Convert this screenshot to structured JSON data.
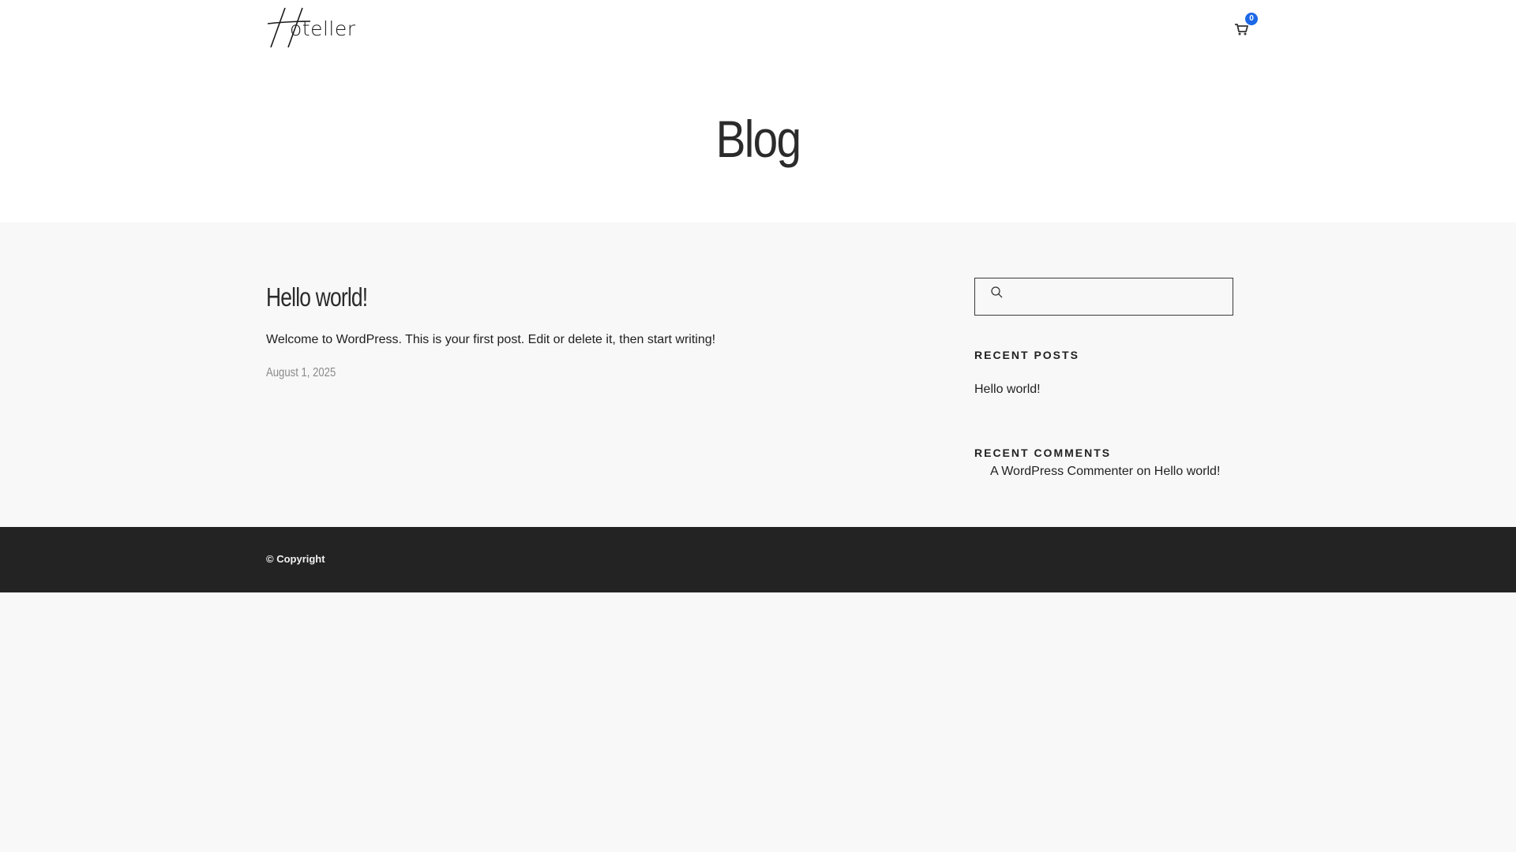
{
  "header": {
    "logo_text": "oteller",
    "cart_count": "0"
  },
  "page": {
    "title": "Blog"
  },
  "post": {
    "title": "Hello world!",
    "excerpt": "Welcome to WordPress. This is your first post. Edit or delete it, then start writing!",
    "date": "August 1, 2025"
  },
  "sidebar": {
    "search_placeholder": "",
    "recent_posts_title": "Recent Posts",
    "recent_posts": [
      "Hello world!"
    ],
    "recent_comments_title": "Recent Comments",
    "recent_comment": {
      "author": "A WordPress Commenter",
      "connector": "on",
      "post": "Hello world!"
    }
  },
  "footer": {
    "copyright": "© Copyright"
  },
  "colors": {
    "badge": "#1c68e6",
    "footer_bg": "#232323",
    "content_bg": "#f8f8f8"
  },
  "icons": {
    "logo": "hoteller-logo",
    "cart": "cart-icon",
    "search": "search-icon"
  }
}
